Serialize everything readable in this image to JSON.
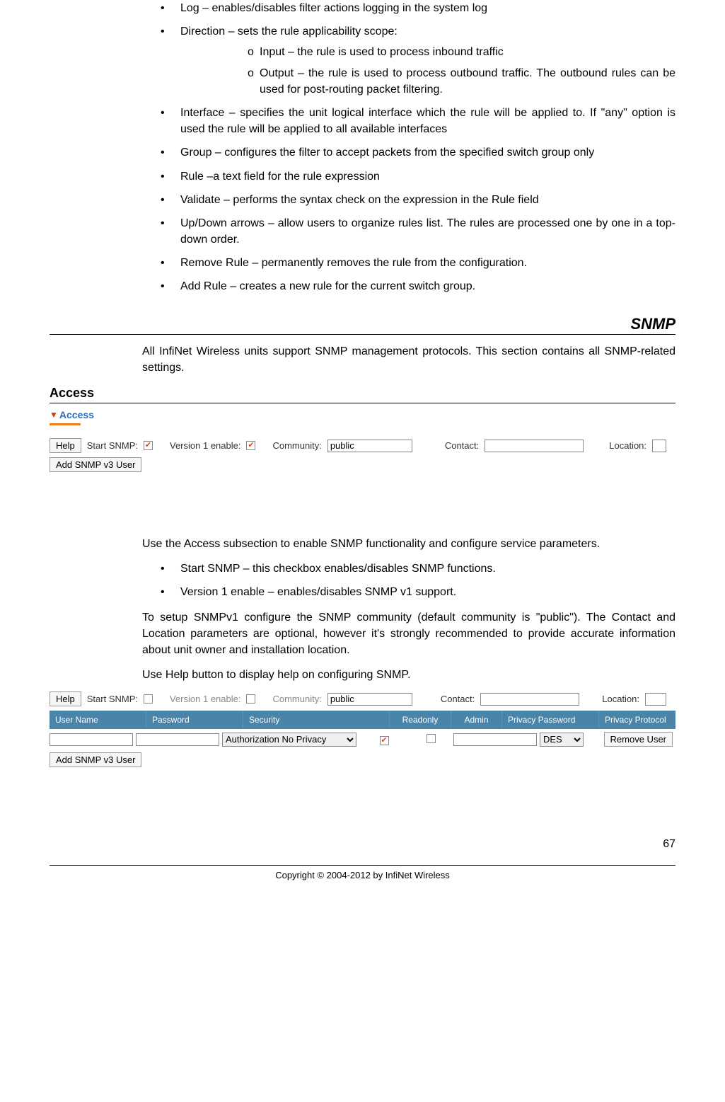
{
  "bullets": {
    "log": "Log – enables/disables filter actions logging in the system log",
    "direction": "Direction – sets the rule applicability scope:",
    "direction_sub": {
      "input": "Input – the rule is used to process inbound traffic",
      "output": "Output – the rule is used to process outbound traffic. The outbound rules can be used for post-routing packet filtering."
    },
    "interface": "Interface – specifies the unit logical interface which the rule will be applied to. If \"any\" option is used the rule will be applied to all available interfaces",
    "group": "Group – configures the filter to accept packets from the specified switch group only",
    "rule": "Rule –a text field for the rule expression",
    "validate": "Validate – performs the syntax check on the expression in the Rule field",
    "updown": "Up/Down arrows – allow users to organize rules list. The rules are processed one by one in a top-down order.",
    "remove": "Remove Rule – permanently removes the rule from the configuration.",
    "add": "Add Rule – creates a new rule for the current switch group."
  },
  "section_snmp": "SNMP",
  "snmp_intro": "All InfiNet Wireless units support SNMP management protocols. This section contains all SNMP-related settings.",
  "subsection_access": "Access",
  "shot1": {
    "access_label": "Access",
    "help_btn": "Help",
    "start_snmp_lbl": "Start SNMP:",
    "v1_lbl": "Version 1 enable:",
    "community_lbl": "Community:",
    "community_val": "public",
    "contact_lbl": "Contact:",
    "location_lbl": "Location:",
    "add_user_btn": "Add SNMP v3 User"
  },
  "access_para": "Use the Access subsection to enable SNMP functionality and configure service parameters.",
  "access_bullets": {
    "start": "Start SNMP – this checkbox enables/disables SNMP functions.",
    "v1": "Version 1 enable – enables/disables SNMP v1 support."
  },
  "snmpv1_para": "To setup SNMPv1 configure the SNMP community (default community is \"public\"). The Contact and Location parameters are optional, however it's strongly recommended to provide accurate information about unit owner and installation location.",
  "help_para": "Use Help button to display help on configuring SNMP.",
  "shot2": {
    "help_btn": "Help",
    "start_snmp_lbl": "Start SNMP:",
    "v1_lbl": "Version 1 enable:",
    "community_lbl": "Community:",
    "community_val": "public",
    "contact_lbl": "Contact:",
    "location_lbl": "Location:",
    "headers": {
      "user": "User Name",
      "pass": "Password",
      "sec": "Security",
      "ro": "Readonly",
      "admin": "Admin",
      "ppass": "Privacy Password",
      "pproto": "Privacy Protocol"
    },
    "security_val": "Authorization No Privacy",
    "pproto_val": "DES",
    "remove_btn": "Remove User",
    "add_user_btn": "Add SNMP v3 User"
  },
  "page_number": "67",
  "copyright": "Copyright © 2004-2012 by InfiNet Wireless"
}
